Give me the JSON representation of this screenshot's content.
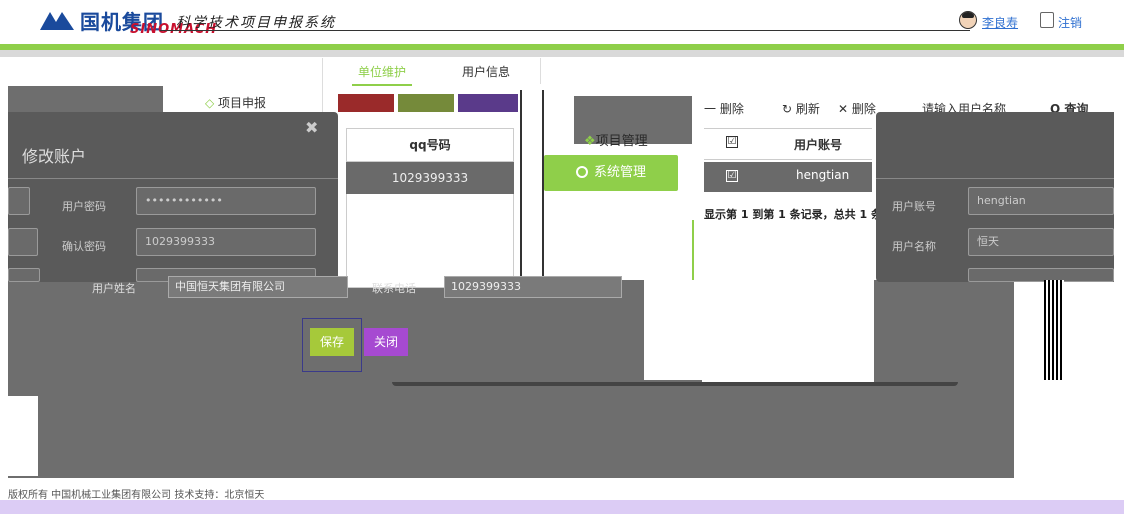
{
  "header": {
    "logo_text": "国机集团",
    "logo_sub": "SINOMACH",
    "system_title": "科学技术项目申报系统",
    "username": "李良寿",
    "logout": "注销"
  },
  "menu": {
    "project_apply": "项目申报",
    "project_manage": "项目管理",
    "system_manage": "系统管理"
  },
  "tabs": {
    "unit_maintain": "单位维护",
    "user_info": "用户信息"
  },
  "edit_dialog": {
    "title": "修改账户",
    "close": "✖",
    "password_label": "用户密码",
    "password_value": "••••••••••••",
    "confirm_label": "确认密码",
    "confirm_value": "1029399333"
  },
  "mid_table": {
    "header": "qq号码",
    "row_value": "1029399333"
  },
  "right_toolbar": {
    "delete": "一 删除",
    "refresh": "↻ 刷新",
    "x": "✕ 删除",
    "search_placeholder": "请输入用户名称",
    "query": "Q 查询"
  },
  "right_table": {
    "check_header": "☑",
    "col_header": "用户账号",
    "check_row": "☑",
    "row_value": "hengtian",
    "summary": "显示第 1 到第 1 条记录，总共 1 条"
  },
  "right_dialog": {
    "label1": "用户账号",
    "value1": "hengtian",
    "label2": "用户名称",
    "value2": "恒天"
  },
  "mid_row": {
    "name_label": "用户姓名",
    "name_value": "中国恒天集团有限公司",
    "tel_label": "联系电话",
    "tel_value": "1029399333"
  },
  "buttons": {
    "save": "保存",
    "close": "关闭"
  },
  "footer": {
    "text": "版权所有 中国机械工业集团有限公司 技术支持：北京恒天"
  }
}
